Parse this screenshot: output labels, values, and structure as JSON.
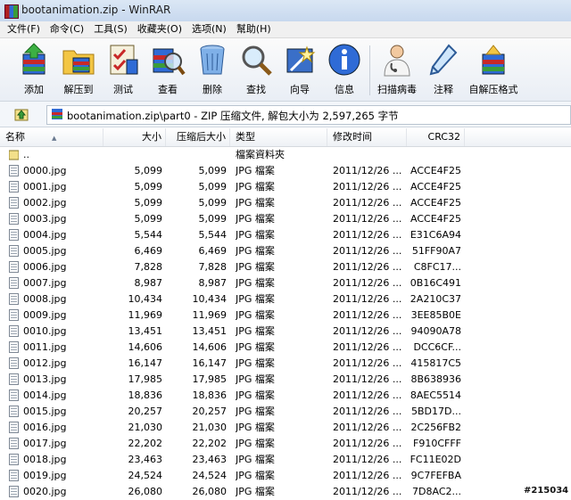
{
  "window": {
    "title": "bootanimation.zip - WinRAR"
  },
  "menu": [
    "文件(F)",
    "命令(C)",
    "工具(S)",
    "收藏夹(O)",
    "选项(N)",
    "幫助(H)"
  ],
  "toolbar": {
    "add": "添加",
    "extract_to": "解压到",
    "test": "测试",
    "view": "查看",
    "delete": "删除",
    "find": "查找",
    "wizard": "向导",
    "info": "信息",
    "virus_scan": "扫描病毒",
    "comment": "注释",
    "sfx": "自解压格式"
  },
  "address": {
    "text": "bootanimation.zip\\part0 - ZIP 压缩文件, 解包大小为 2,597,265 字节"
  },
  "columns": {
    "name": "名称",
    "size": "大小",
    "packed": "压缩后大小",
    "type": "类型",
    "modified": "修改时间",
    "crc": "CRC32"
  },
  "parent_row": {
    "name": "..",
    "type": "檔案資料夾"
  },
  "files": [
    {
      "name": "0000.jpg",
      "size": "5,099",
      "packed": "5,099",
      "type": "JPG 檔案",
      "modified": "2011/12/26 ...",
      "crc": "ACCE4F25"
    },
    {
      "name": "0001.jpg",
      "size": "5,099",
      "packed": "5,099",
      "type": "JPG 檔案",
      "modified": "2011/12/26 ...",
      "crc": "ACCE4F25"
    },
    {
      "name": "0002.jpg",
      "size": "5,099",
      "packed": "5,099",
      "type": "JPG 檔案",
      "modified": "2011/12/26 ...",
      "crc": "ACCE4F25"
    },
    {
      "name": "0003.jpg",
      "size": "5,099",
      "packed": "5,099",
      "type": "JPG 檔案",
      "modified": "2011/12/26 ...",
      "crc": "ACCE4F25"
    },
    {
      "name": "0004.jpg",
      "size": "5,544",
      "packed": "5,544",
      "type": "JPG 檔案",
      "modified": "2011/12/26 ...",
      "crc": "E31C6A94"
    },
    {
      "name": "0005.jpg",
      "size": "6,469",
      "packed": "6,469",
      "type": "JPG 檔案",
      "modified": "2011/12/26 ...",
      "crc": "51FF90A7"
    },
    {
      "name": "0006.jpg",
      "size": "7,828",
      "packed": "7,828",
      "type": "JPG 檔案",
      "modified": "2011/12/26 ...",
      "crc": "C8FC17..."
    },
    {
      "name": "0007.jpg",
      "size": "8,987",
      "packed": "8,987",
      "type": "JPG 檔案",
      "modified": "2011/12/26 ...",
      "crc": "0B16C491"
    },
    {
      "name": "0008.jpg",
      "size": "10,434",
      "packed": "10,434",
      "type": "JPG 檔案",
      "modified": "2011/12/26 ...",
      "crc": "2A210C37"
    },
    {
      "name": "0009.jpg",
      "size": "11,969",
      "packed": "11,969",
      "type": "JPG 檔案",
      "modified": "2011/12/26 ...",
      "crc": "3EE85B0E"
    },
    {
      "name": "0010.jpg",
      "size": "13,451",
      "packed": "13,451",
      "type": "JPG 檔案",
      "modified": "2011/12/26 ...",
      "crc": "94090A78"
    },
    {
      "name": "0011.jpg",
      "size": "14,606",
      "packed": "14,606",
      "type": "JPG 檔案",
      "modified": "2011/12/26 ...",
      "crc": "DCC6CF..."
    },
    {
      "name": "0012.jpg",
      "size": "16,147",
      "packed": "16,147",
      "type": "JPG 檔案",
      "modified": "2011/12/26 ...",
      "crc": "415817C5"
    },
    {
      "name": "0013.jpg",
      "size": "17,985",
      "packed": "17,985",
      "type": "JPG 檔案",
      "modified": "2011/12/26 ...",
      "crc": "8B638936"
    },
    {
      "name": "0014.jpg",
      "size": "18,836",
      "packed": "18,836",
      "type": "JPG 檔案",
      "modified": "2011/12/26 ...",
      "crc": "8AEC5514"
    },
    {
      "name": "0015.jpg",
      "size": "20,257",
      "packed": "20,257",
      "type": "JPG 檔案",
      "modified": "2011/12/26 ...",
      "crc": "5BD17D..."
    },
    {
      "name": "0016.jpg",
      "size": "21,030",
      "packed": "21,030",
      "type": "JPG 檔案",
      "modified": "2011/12/26 ...",
      "crc": "2C256FB2"
    },
    {
      "name": "0017.jpg",
      "size": "22,202",
      "packed": "22,202",
      "type": "JPG 檔案",
      "modified": "2011/12/26 ...",
      "crc": "F910CFFF"
    },
    {
      "name": "0018.jpg",
      "size": "23,463",
      "packed": "23,463",
      "type": "JPG 檔案",
      "modified": "2011/12/26 ...",
      "crc": "FC11E02D"
    },
    {
      "name": "0019.jpg",
      "size": "24,524",
      "packed": "24,524",
      "type": "JPG 檔案",
      "modified": "2011/12/26 ...",
      "crc": "9C7FEFBA"
    },
    {
      "name": "0020.jpg",
      "size": "26,080",
      "packed": "26,080",
      "type": "JPG 檔案",
      "modified": "2011/12/26 ...",
      "crc": "7D8AC2..."
    }
  ],
  "watermark": "#215034",
  "icons": {
    "add": "archive-add-icon",
    "extract": "extract-folder-icon",
    "test": "test-checklist-icon",
    "view": "view-magnifier-icon",
    "delete": "trash-icon",
    "find": "find-magnifier-icon",
    "wizard": "wizard-wand-icon",
    "info": "info-icon",
    "virus": "doctor-icon",
    "comment": "comment-pen-icon",
    "sfx": "sfx-package-icon"
  }
}
